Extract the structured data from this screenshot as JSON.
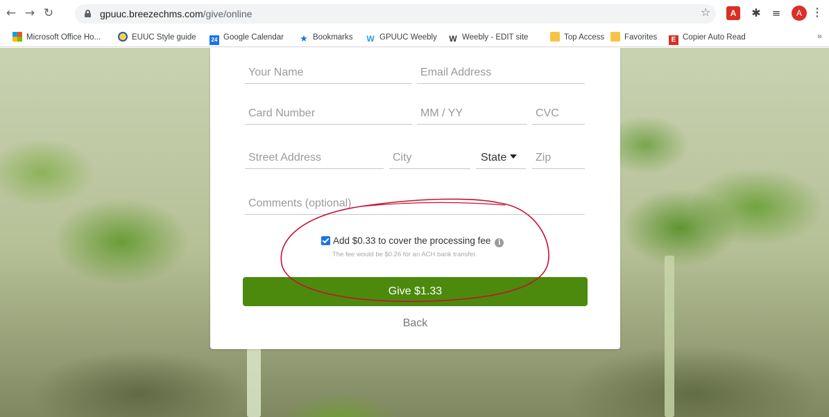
{
  "browser": {
    "url_host": "gpuuc.breezechms.com",
    "url_path": "/give/online",
    "avatar_letter": "A",
    "pdf_ext_label": "A",
    "icons": {
      "back": "back-arrow-icon",
      "forward": "forward-arrow-icon",
      "reload": "reload-icon",
      "lock": "lock-icon",
      "star": "bookmark-star-icon",
      "pdf": "acrobat-pdf-icon",
      "extensions": "puzzle-icon",
      "media": "media-queue-icon",
      "menu": "kebab-menu-icon"
    }
  },
  "bookmarks": [
    {
      "label": "Microsoft Office Ho...",
      "icon": "microsoft-icon"
    },
    {
      "label": "EUUC Style guide",
      "icon": "euuc-icon"
    },
    {
      "label": "Google Calendar",
      "icon": "calendar-icon",
      "badge": "24"
    },
    {
      "label": "Bookmarks",
      "icon": "star-icon"
    },
    {
      "label": "GPUUC Weebly",
      "icon": "weebly-icon"
    },
    {
      "label": "Weebly - EDIT site",
      "icon": "weebly-icon"
    },
    {
      "label": "Top Access",
      "icon": "folder-icon"
    },
    {
      "label": "Favorites",
      "icon": "folder-icon"
    },
    {
      "label": "Copier Auto Read",
      "icon": "e-icon",
      "badge": "E"
    }
  ],
  "bookmarks_more": "»",
  "form": {
    "name_placeholder": "Your Name",
    "email_placeholder": "Email Address",
    "card_placeholder": "Card Number",
    "expiry_placeholder": "MM / YY",
    "cvc_placeholder": "CVC",
    "street_placeholder": "Street Address",
    "city_placeholder": "City",
    "state_label": "State",
    "zip_placeholder": "Zip",
    "comments_placeholder": "Comments (optional)",
    "fee_checkbox_checked": true,
    "fee_label": "Add $0.33 to cover the processing fee",
    "fee_note": "The fee would be $0.26 for an ACH bank transfer.",
    "give_button": "Give $1.33",
    "back_link": "Back"
  },
  "colors": {
    "give_button": "#4b8a0d",
    "annotation_circle": "#c8102e",
    "checkbox": "#1a73e8"
  }
}
